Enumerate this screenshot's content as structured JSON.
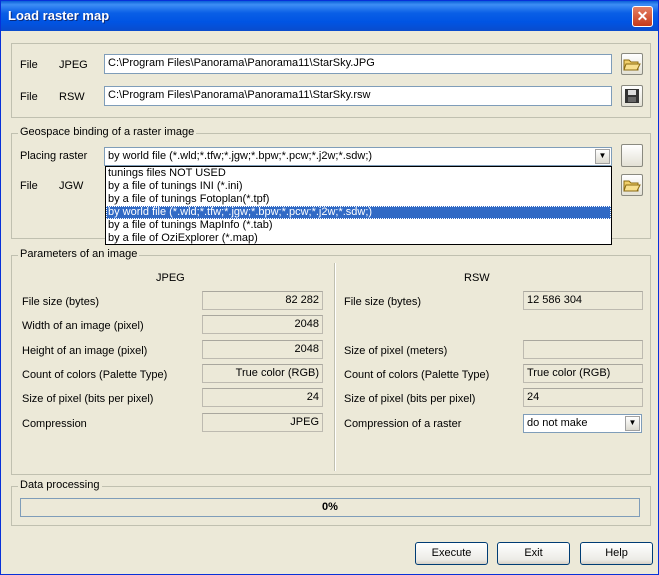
{
  "window": {
    "title": "Load raster map",
    "close_glyph": "✕"
  },
  "files": {
    "jpeg": {
      "label": "File",
      "type": "JPEG",
      "value": "C:\\Program Files\\Panorama\\Panorama11\\StarSky.JPG",
      "icon": "folder-open-icon"
    },
    "rsw": {
      "label": "File",
      "type": "RSW",
      "value": "C:\\Program Files\\Panorama\\Panorama11\\StarSky.rsw",
      "icon": "floppy-save-icon"
    }
  },
  "geo": {
    "legend": "Geospace binding of a raster image",
    "placing_label": "Placing raster",
    "placing_value": "by world file (*.wld;*.tfw;*.jgw;*.bpw;*.pcw;*.j2w;*.sdw;)",
    "file_label": "File",
    "file_type": "JGW",
    "options": [
      "tunings files NOT USED",
      "by a file of tunings INI (*.ini)",
      "by a file of tunings Fotoplan(*.tpf)",
      "by world file (*.wld;*.tfw;*.jgw;*.bpw;*.pcw;*.j2w;*.sdw;)",
      "by a file of tunings MapInfo (*.tab)",
      "by a file of OziExplorer (*.map)"
    ],
    "selected_index": 3
  },
  "params": {
    "legend": "Parameters of an image",
    "jpeg": {
      "header": "JPEG",
      "rows": [
        {
          "label": "File size (bytes)",
          "value": "82 282"
        },
        {
          "label": "Width of an image (pixel)",
          "value": "2048"
        },
        {
          "label": "Height of an image (pixel)",
          "value": "2048"
        },
        {
          "label": "Count of colors (Palette Type)",
          "value": "True color (RGB)"
        },
        {
          "label": "Size of pixel (bits per pixel)",
          "value": "24"
        },
        {
          "label": "Compression",
          "value": "JPEG"
        }
      ]
    },
    "rsw": {
      "header": "RSW",
      "file_size_label": "File size (bytes)",
      "file_size": "12 586 304",
      "pixel_size_label": "Size of pixel (meters)",
      "pixel_size": "",
      "colors_label": "Count of colors (Palette Type)",
      "colors": "True color (RGB)",
      "bits_label": "Size of pixel (bits per pixel)",
      "bits": "24",
      "compression_label": "Compression of a raster",
      "compression": "do not make"
    }
  },
  "processing": {
    "legend": "Data processing",
    "progress_text": "0%",
    "progress_value": 0
  },
  "buttons": {
    "execute": "Execute",
    "exit": "Exit",
    "help": "Help"
  }
}
